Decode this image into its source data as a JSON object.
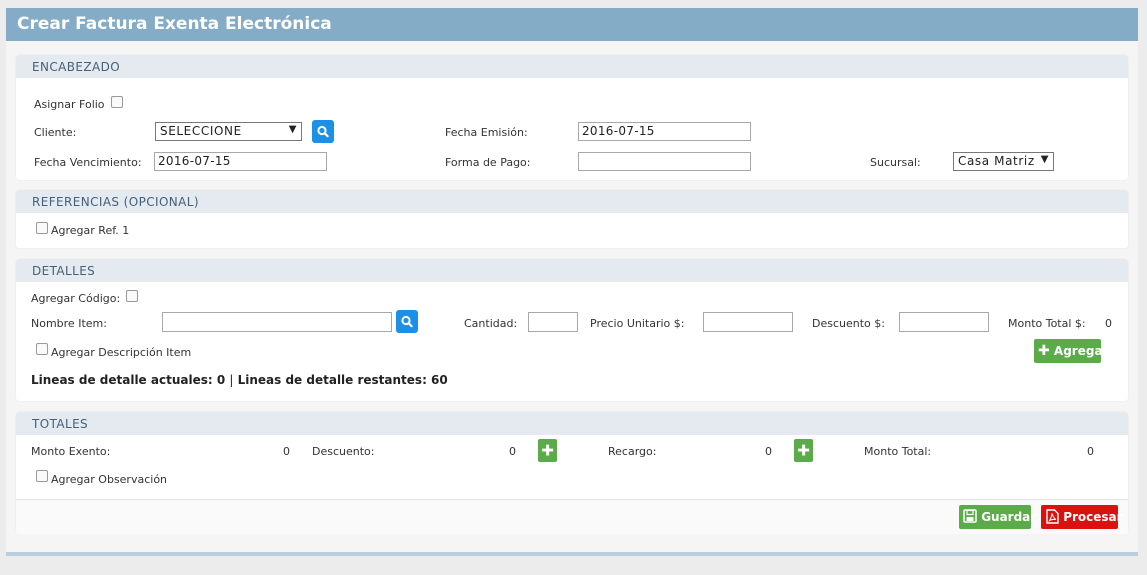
{
  "title": "Crear Factura Exenta Electrónica",
  "encabezado": {
    "heading": "ENCABEZADO",
    "asignar_folio": "Asignar Folio",
    "cliente_label": "Cliente:",
    "cliente_value": "SELECCIONE",
    "fecha_emision_label": "Fecha Emisión:",
    "fecha_emision_value": "2016-07-15",
    "fecha_vencimiento_label": "Fecha Vencimiento:",
    "fecha_vencimiento_value": "2016-07-15",
    "forma_pago_label": "Forma de Pago:",
    "forma_pago_value": "",
    "sucursal_label": "Sucursal:",
    "sucursal_value": "Casa Matriz"
  },
  "referencias": {
    "heading": "REFERENCIAS (OPCIONAL)",
    "agregar_ref": "Agregar Ref. 1"
  },
  "detalles": {
    "heading": "DETALLES",
    "agregar_codigo": "Agregar Código:",
    "nombre_item_label": "Nombre Item:",
    "nombre_item_value": "",
    "cantidad_label": "Cantidad:",
    "cantidad_value": "",
    "precio_unitario_label": "Precio Unitario $:",
    "precio_unitario_value": "",
    "descuento_label": "Descuento $:",
    "descuento_value": "",
    "monto_total_label": "Monto Total $:",
    "monto_total_value": "0",
    "agregar_descripcion": "Agregar Descripción Item",
    "agregar_button": "Agregar",
    "lineas_actuales": "Lineas de detalle actuales: 0",
    "separator": "|",
    "lineas_restantes": "Lineas de detalle restantes: 60"
  },
  "totales": {
    "heading": "TOTALES",
    "monto_exento_label": "Monto Exento:",
    "monto_exento_value": "0",
    "descuento_label": "Descuento:",
    "descuento_value": "0",
    "recargo_label": "Recargo:",
    "recargo_value": "0",
    "monto_total_label": "Monto Total:",
    "monto_total_value": "0",
    "agregar_observacion": "Agregar Observación",
    "guardar_button": "Guardar",
    "procesar_button": "Procesar"
  },
  "colors": {
    "title_bar": "#84acc7",
    "panel_header": "#e4eaf0",
    "search_button": "#1c8fe6",
    "green_button": "#5bab4a",
    "red_button": "#d9120f"
  },
  "icons": {
    "search": "search-icon",
    "plus": "plus-icon",
    "save": "floppy-disk-icon",
    "pdf": "pdf-file-icon",
    "dropdown": "chevron-down-icon"
  }
}
